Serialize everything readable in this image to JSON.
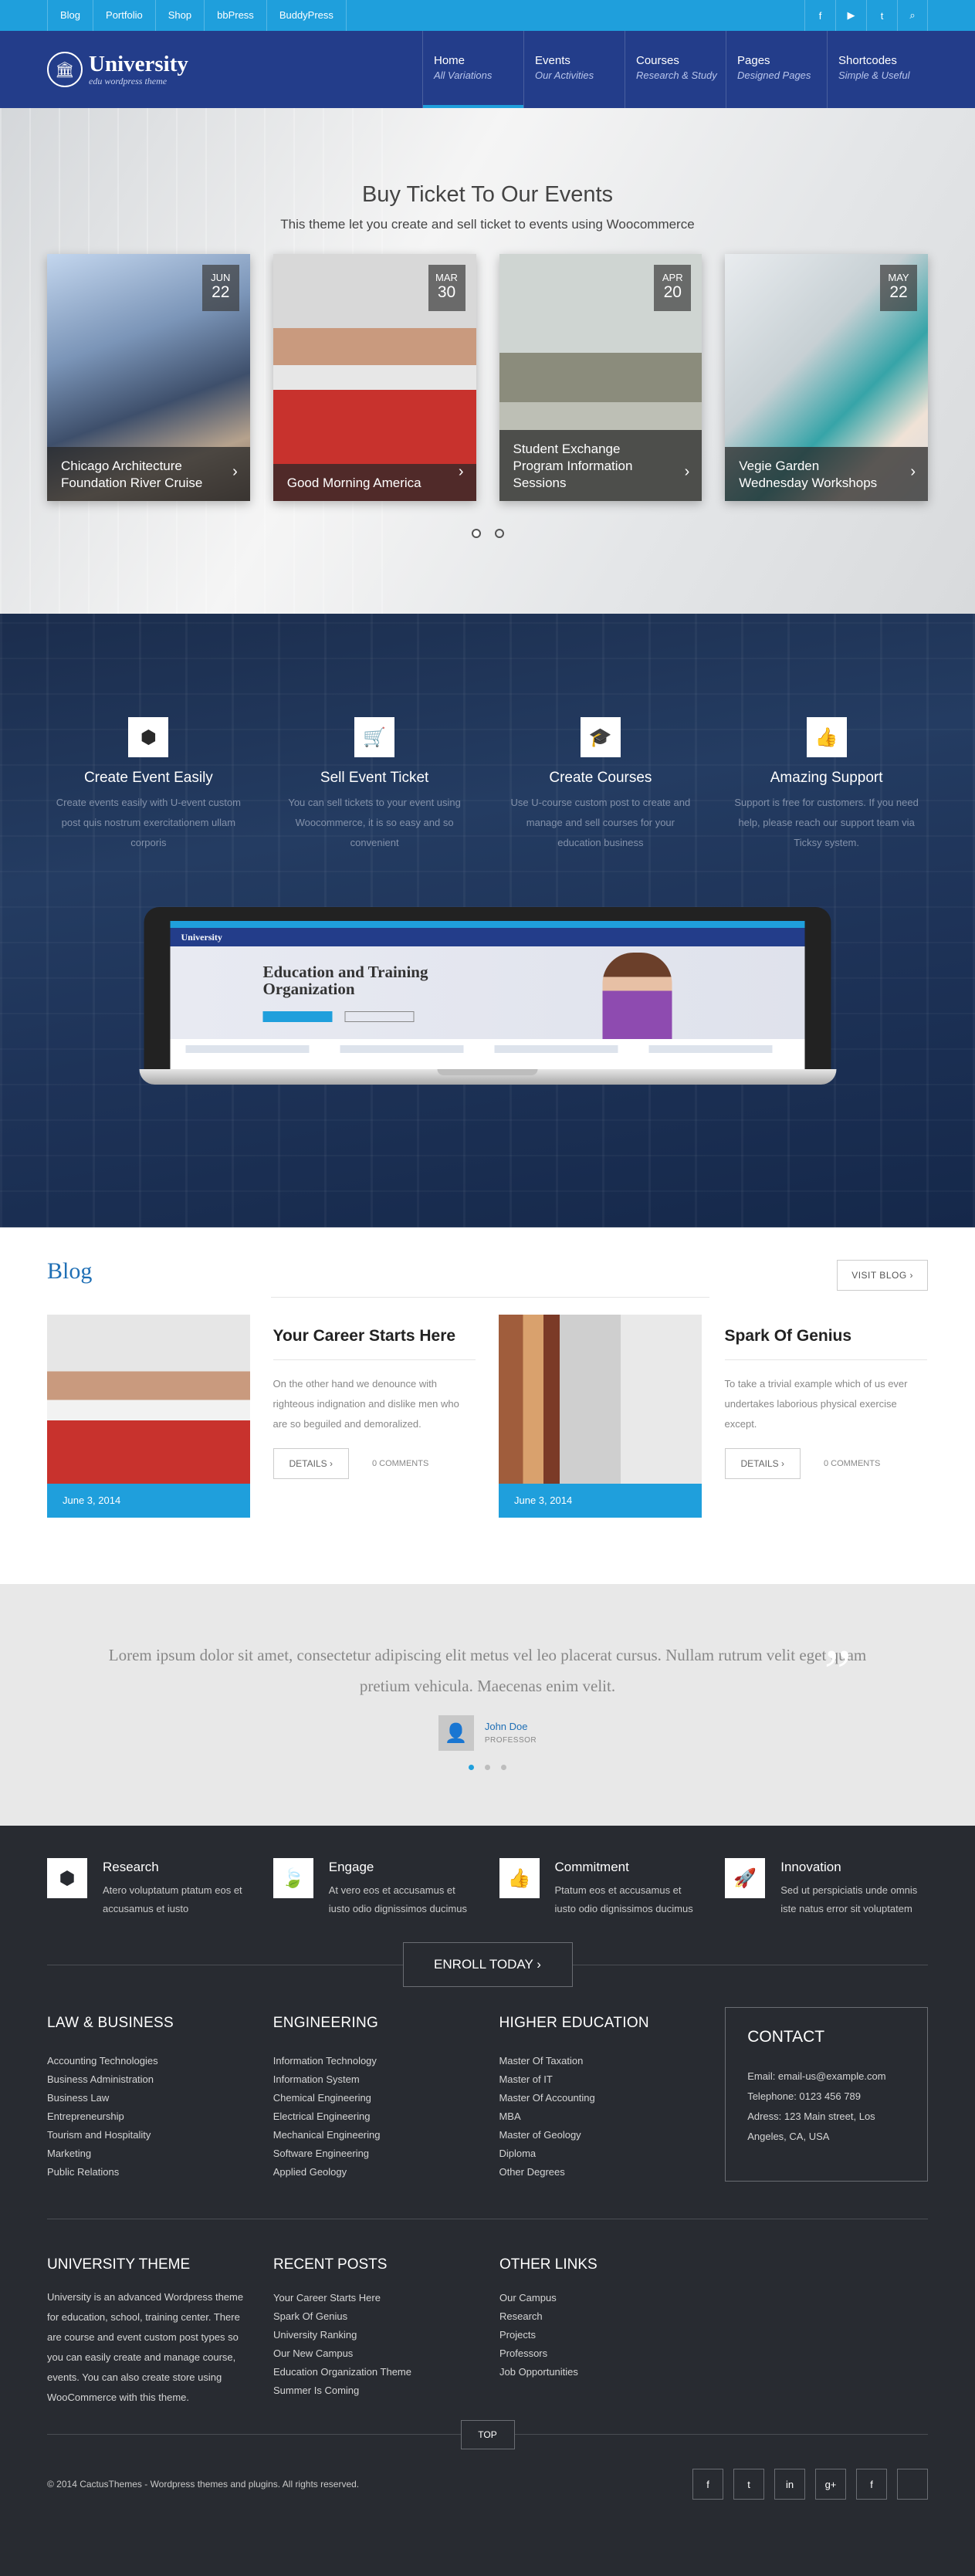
{
  "topbar": {
    "links": [
      "Blog",
      "Portfolio",
      "Shop",
      "bbPress",
      "BuddyPress"
    ],
    "social_icons": [
      "f",
      "▶",
      "t",
      "⌕"
    ]
  },
  "header": {
    "logo_title": "University",
    "logo_sub": "edu wordpress theme",
    "nav": [
      {
        "label": "Home",
        "sub": "All Variations"
      },
      {
        "label": "Events",
        "sub": "Our Activities"
      },
      {
        "label": "Courses",
        "sub": "Research & Study"
      },
      {
        "label": "Pages",
        "sub": "Designed Pages"
      },
      {
        "label": "Shortcodes",
        "sub": "Simple & Useful"
      }
    ]
  },
  "events": {
    "title": "Buy Ticket To Our Events",
    "subtitle": "This theme let you create and sell ticket to events using Woocommerce",
    "cards": [
      {
        "month": "JUN",
        "day": "22",
        "title": "Chicago Architecture Foundation River Cruise"
      },
      {
        "month": "MAR",
        "day": "30",
        "title": "Good Morning America"
      },
      {
        "month": "APR",
        "day": "20",
        "title": "Student Exchange Program Information Sessions"
      },
      {
        "month": "MAY",
        "day": "22",
        "title": "Vegie Garden Wednesday Workshops"
      }
    ]
  },
  "features": {
    "items": [
      {
        "icon": "box-icon",
        "title": "Create Event Easily",
        "text": "Create events easily with U-event custom post quis nostrum exercitationem ullam corporis"
      },
      {
        "icon": "cart-icon",
        "title": "Sell Event Ticket",
        "text": "You can sell tickets to your event using Woocommerce, it is so easy and so convenient"
      },
      {
        "icon": "graduation-cap-icon",
        "title": "Create Courses",
        "text": "Use U-course custom post to create and manage and sell courses for your education business"
      },
      {
        "icon": "thumbs-up-icon",
        "title": "Amazing Support",
        "text": "Support is free for customers. If you need help, please reach our support team via Ticksy system."
      }
    ],
    "mock_logo": "University",
    "mock_title": "Education and Training Organization"
  },
  "blog": {
    "title": "Blog",
    "visit_label": "VISIT BLOG ›",
    "posts": [
      {
        "date": "June 3, 2014",
        "title": "Your Career Starts Here",
        "excerpt": "On the other hand we denounce with righteous indignation and dislike men who are so beguiled and demoralized.",
        "details": "DETAILS ›",
        "comments": "0 COMMENTS"
      },
      {
        "date": "June 3, 2014",
        "title": "Spark Of Genius",
        "excerpt": "To take a trivial example which of us ever undertakes laborious physical exercise except.",
        "details": "DETAILS ›",
        "comments": "0 COMMENTS"
      }
    ]
  },
  "testimonial": {
    "quote": "Lorem ipsum dolor sit amet, consectetur adipiscing elit metus vel leo placerat cursus. Nullam rutrum velit eget quam pretium vehicula. Maecenas enim velit.",
    "name": "John Doe",
    "role": "PROFESSOR"
  },
  "footer": {
    "features": [
      {
        "icon": "box-icon",
        "title": "Research",
        "text": "Atero voluptatum ptatum eos et accusamus et iusto"
      },
      {
        "icon": "leaf-icon",
        "title": "Engage",
        "text": "At vero eos et accusamus et iusto odio dignissimos ducimus"
      },
      {
        "icon": "thumbs-up-icon",
        "title": "Commitment",
        "text": "Ptatum eos et accusamus et iusto odio dignissimos ducimus"
      },
      {
        "icon": "rocket-icon",
        "title": "Innovation",
        "text": "Sed ut perspiciatis unde omnis iste natus error sit voluptatem"
      }
    ],
    "enroll": "ENROLL TODAY ›",
    "columns": [
      {
        "title": "LAW & BUSINESS",
        "items": [
          "Accounting Technologies",
          "Business Administration",
          "Business Law",
          "Entrepreneurship",
          "Tourism and Hospitality",
          "Marketing",
          "Public Relations"
        ]
      },
      {
        "title": "ENGINEERING",
        "items": [
          "Information Technology",
          "Information System",
          "Chemical Engineering",
          "Electrical Engineering",
          "Mechanical Engineering",
          "Software Engineering",
          "Applied Geology"
        ]
      },
      {
        "title": "HIGHER EDUCATION",
        "items": [
          "Master Of Taxation",
          "Master of IT",
          "Master Of Accounting",
          "MBA",
          "Master of Geology",
          "Diploma",
          "Other Degrees"
        ]
      }
    ],
    "contact": {
      "title": "CONTACT",
      "email": "Email: email-us@example.com",
      "phone": "Telephone: 0123 456 789",
      "address": "Adress: 123 Main street, Los Angeles, CA, USA"
    },
    "about_title": "UNIVERSITY THEME",
    "about_text": "University is an advanced Wordpress theme for education, school, training center. There are course and event custom post types so you can easily create and manage course, events. You can also create store using WooCommerce with this theme.",
    "recent_title": "RECENT POSTS",
    "recent": [
      "Your Career Starts Here",
      "Spark Of Genius",
      "University Ranking",
      "Our New Campus",
      "Education Organization Theme",
      "Summer Is Coming"
    ],
    "other_title": "OTHER LINKS",
    "other": [
      "Our Campus",
      "Research",
      "Projects",
      "Professors",
      "Job Opportunities"
    ],
    "top_label": "TOP",
    "copyright": "© 2014 CactusThemes - Wordpress themes and plugins. All rights reserved.",
    "social_icons": [
      "f",
      "t",
      "in",
      "g+",
      "f",
      ""
    ]
  }
}
